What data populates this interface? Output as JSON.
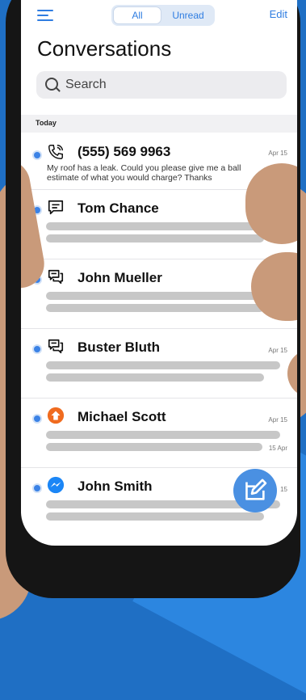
{
  "header": {
    "all_label": "All",
    "unread_label": "Unread",
    "edit_label": "Edit",
    "title": "Conversations"
  },
  "search": {
    "placeholder": "Search"
  },
  "section_label": "Today",
  "conversations": [
    {
      "name": "(555) 569 9963",
      "date": "Apr 15",
      "message": "My roof has a leak. Could you please give me a ball estimate of what you would charge?  Thanks",
      "icon": "phone-icon"
    },
    {
      "name": "Tom Chance",
      "date": "",
      "icon": "sms-icon"
    },
    {
      "name": "John Mueller",
      "date": "",
      "icon": "chat-icon"
    },
    {
      "name": "Buster Bluth",
      "date": "Apr 15",
      "icon": "chat-icon"
    },
    {
      "name": "Michael Scott",
      "date": "Apr 15",
      "date2": "15 Apr",
      "icon": "orange-badge-icon"
    },
    {
      "name": "John Smith",
      "date": "15",
      "icon": "messenger-icon"
    }
  ],
  "colors": {
    "accent": "#2f7de1",
    "unread_dot": "#3b82e6",
    "fab": "#4a90e2",
    "skin": "#c99a7a"
  }
}
